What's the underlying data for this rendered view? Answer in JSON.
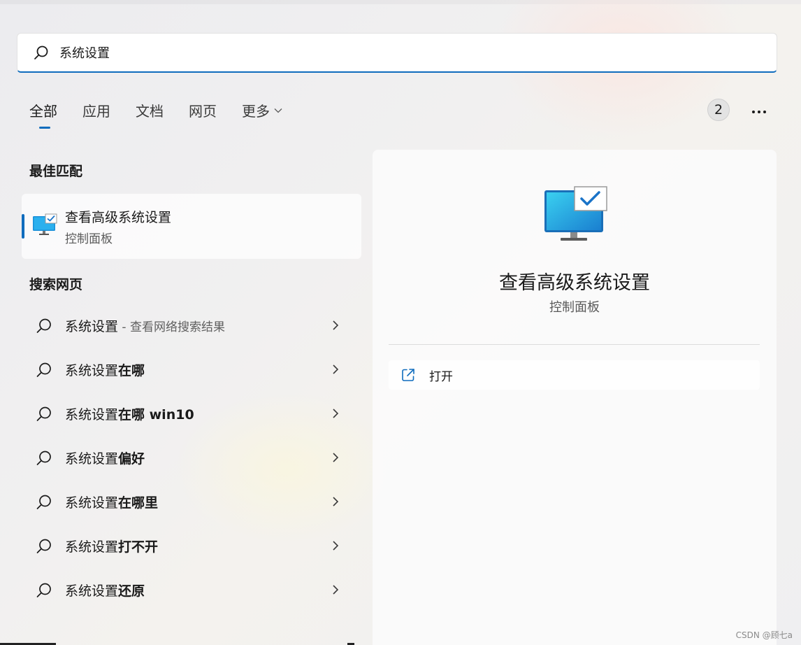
{
  "search": {
    "value": "系统设置"
  },
  "tabs": [
    {
      "label": "全部",
      "active": true
    },
    {
      "label": "应用"
    },
    {
      "label": "文档"
    },
    {
      "label": "网页"
    },
    {
      "label": "更多"
    }
  ],
  "badge_count": "2",
  "best_match": {
    "heading": "最佳匹配",
    "title": "查看高级系统设置",
    "subtitle": "控制面板"
  },
  "web_search": {
    "heading": "搜索网页",
    "items": [
      {
        "prefix": "系统设置",
        "suffix": "",
        "hint": " - 查看网络搜索结果"
      },
      {
        "prefix": "系统设置",
        "suffix": "在哪",
        "hint": ""
      },
      {
        "prefix": "系统设置",
        "suffix": "在哪 win10",
        "hint": ""
      },
      {
        "prefix": "系统设置",
        "suffix": "偏好",
        "hint": ""
      },
      {
        "prefix": "系统设置",
        "suffix": "在哪里",
        "hint": ""
      },
      {
        "prefix": "系统设置",
        "suffix": "打不开",
        "hint": ""
      },
      {
        "prefix": "系统设置",
        "suffix": "还原",
        "hint": ""
      }
    ]
  },
  "preview": {
    "title": "查看高级系统设置",
    "subtitle": "控制面板",
    "open_label": "打开"
  },
  "watermark": "CSDN @顾七a",
  "colors": {
    "accent": "#0f6cbd",
    "icon_blue": "#1a8fd8"
  },
  "icons": [
    "search-icon",
    "chevron-down-icon",
    "more-icon",
    "system-settings-icon",
    "chevron-right-icon",
    "open-external-icon"
  ]
}
